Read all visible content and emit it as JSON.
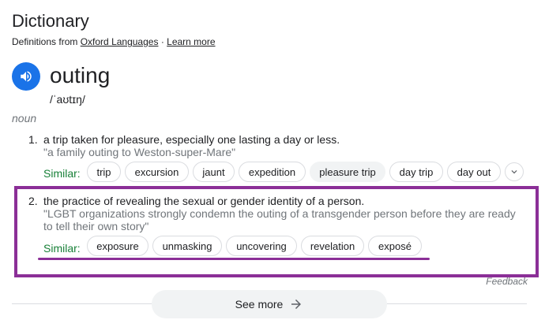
{
  "header": {
    "title": "Dictionary",
    "source_prefix": "Definitions from",
    "source_link": "Oxford Languages",
    "separator": "·",
    "learn_more": "Learn more"
  },
  "entry": {
    "word": "outing",
    "phonetic": "/ˈaʊtɪŋ/",
    "part_of_speech": "noun"
  },
  "definitions": [
    {
      "number": "1.",
      "text": "a trip taken for pleasure, especially one lasting a day or less.",
      "example": "\"a family outing to Weston-super-Mare\"",
      "similar_label": "Similar:",
      "similar": [
        "trip",
        "excursion",
        "jaunt",
        "expedition",
        "pleasure trip",
        "day trip",
        "day out"
      ]
    },
    {
      "number": "2.",
      "text": "the practice of revealing the sexual or gender identity of a person.",
      "example_line1": "\"LGBT organizations strongly condemn the outing of a transgender person before they are ready",
      "example_line2": "to tell their own story\"",
      "similar_label": "Similar:",
      "similar": [
        "exposure",
        "unmasking",
        "uncovering",
        "revelation",
        "exposé"
      ]
    }
  ],
  "footer": {
    "feedback": "Feedback",
    "see_more": "See more"
  },
  "colors": {
    "accent_blue": "#1a73e8",
    "similar_green": "#188038",
    "highlight_purple": "#8b2f97"
  },
  "icons": [
    "speaker-icon",
    "chevron-down-icon",
    "arrow-right-icon"
  ]
}
